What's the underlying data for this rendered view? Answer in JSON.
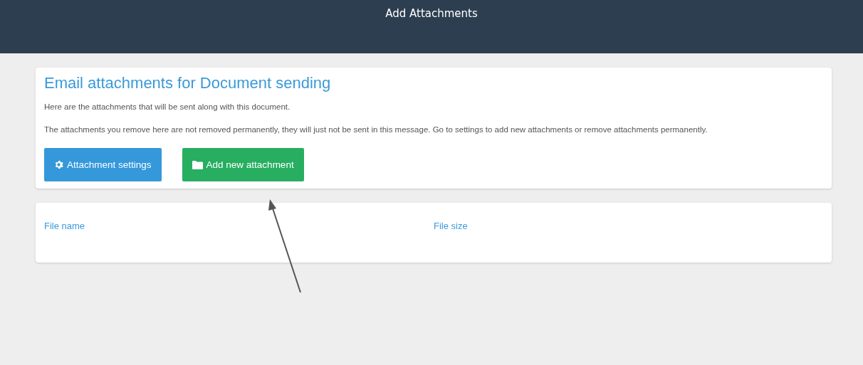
{
  "header": {
    "title": "Add Attachments"
  },
  "card": {
    "heading": "Email attachments for Document sending",
    "paragraphs": [
      "Here are the attachments that will be sent along with this document.",
      "The attachments you remove here are not removed permanently, they will just not be sent in this message. Go to settings to add new attachments or remove attachments permanently."
    ],
    "buttons": [
      {
        "label": "Attachment settings",
        "kind": "settings"
      },
      {
        "label": "Add new attachment",
        "kind": "add"
      }
    ]
  },
  "table": {
    "columns": [
      "File name",
      "File size"
    ]
  }
}
